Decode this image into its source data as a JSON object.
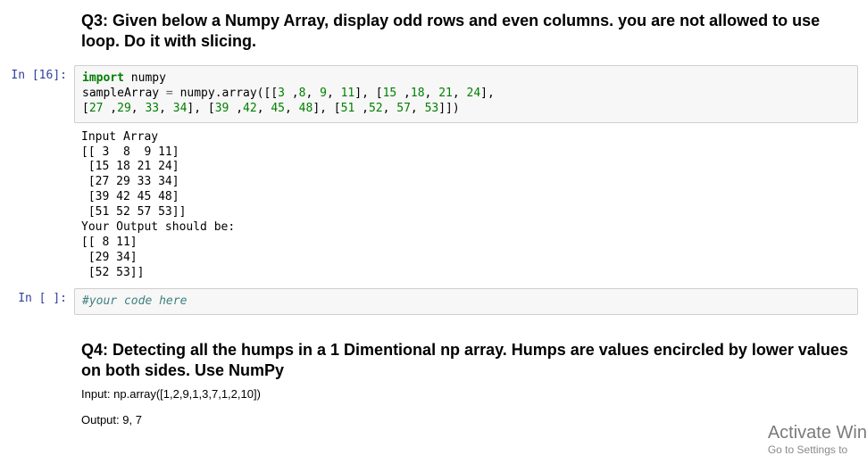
{
  "q3": {
    "heading": "Q3: Given below a Numpy Array, display odd rows and even columns. you are not allowed to use loop. Do it with slicing."
  },
  "cell1": {
    "prompt": "In [16]:",
    "code": {
      "kw_import": "import",
      "mod": " numpy",
      "line2a": "sampleArray ",
      "eq": "=",
      "line2b": " numpy.array([[",
      "n1": "3",
      "c1": " ,",
      "n2": "8",
      "c2": ", ",
      "n3": "9",
      "c3": ", ",
      "n4": "11",
      "c4": "], [",
      "n5": "15",
      "c5": " ,",
      "n6": "18",
      "c6": ", ",
      "n7": "21",
      "c7": ", ",
      "n8": "24",
      "c8": "],\n[",
      "n9": "27",
      "c9": " ,",
      "n10": "29",
      "c10": ", ",
      "n11": "33",
      "c11": ", ",
      "n12": "34",
      "c12": "], [",
      "n13": "39",
      "c13": " ,",
      "n14": "42",
      "c14": ", ",
      "n15": "45",
      "c15": ", ",
      "n16": "48",
      "c16": "], [",
      "n17": "51",
      "c17": " ,",
      "n18": "52",
      "c18": ", ",
      "n19": "57",
      "c19": ", ",
      "n20": "53",
      "c20": "]])"
    },
    "output": "Input Array\n[[ 3  8  9 11]\n [15 18 21 24]\n [27 29 33 34]\n [39 42 45 48]\n [51 52 57 53]]\nYour Output should be:\n[[ 8 11]\n [29 34]\n [52 53]]"
  },
  "cell2": {
    "prompt": "In [ ]:",
    "comment": "#your code here"
  },
  "q4": {
    "heading": "Q4: Detecting all the humps in a 1 Dimentional np array. Humps are values encircled by lower values on both sides. Use NumPy",
    "input_line": "Input: np.array([1,2,9,1,3,7,1,2,10])",
    "output_line": "Output: 9, 7"
  },
  "watermark": {
    "title": "Activate Win",
    "sub": "Go to Settings to"
  }
}
